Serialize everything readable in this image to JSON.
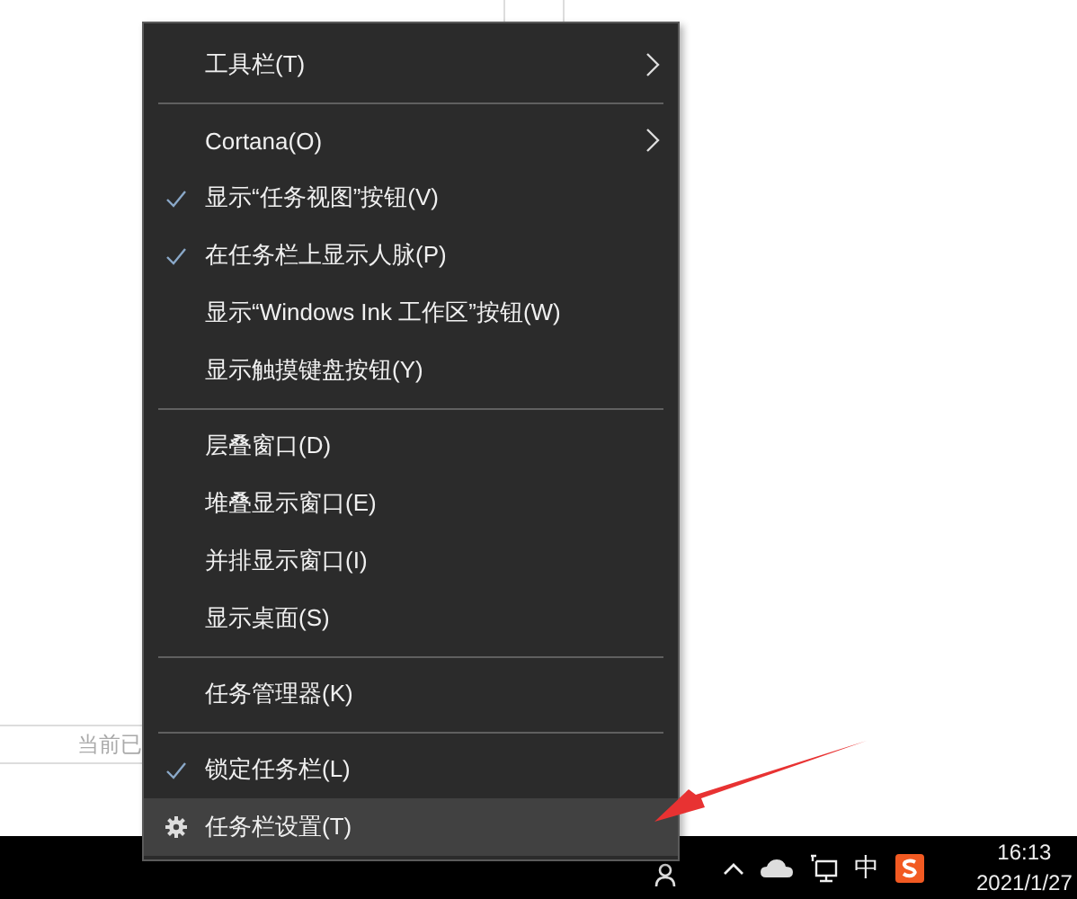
{
  "background": {
    "status_text": "当前已"
  },
  "menu": {
    "items": [
      {
        "kind": "item",
        "label": "工具栏(T)",
        "checked": false,
        "submenu": true,
        "selected": false
      },
      {
        "kind": "separator"
      },
      {
        "kind": "item",
        "label": "Cortana(O)",
        "checked": false,
        "submenu": true,
        "selected": false
      },
      {
        "kind": "item",
        "label": "显示“任务视图”按钮(V)",
        "checked": true,
        "submenu": false,
        "selected": false
      },
      {
        "kind": "item",
        "label": "在任务栏上显示人脉(P)",
        "checked": true,
        "submenu": false,
        "selected": false
      },
      {
        "kind": "item",
        "label": "显示“Windows Ink 工作区”按钮(W)",
        "checked": false,
        "submenu": false,
        "selected": false
      },
      {
        "kind": "item",
        "label": "显示触摸键盘按钮(Y)",
        "checked": false,
        "submenu": false,
        "selected": false
      },
      {
        "kind": "separator"
      },
      {
        "kind": "item",
        "label": "层叠窗口(D)",
        "checked": false,
        "submenu": false,
        "selected": false
      },
      {
        "kind": "item",
        "label": "堆叠显示窗口(E)",
        "checked": false,
        "submenu": false,
        "selected": false
      },
      {
        "kind": "item",
        "label": "并排显示窗口(I)",
        "checked": false,
        "submenu": false,
        "selected": false
      },
      {
        "kind": "item",
        "label": "显示桌面(S)",
        "checked": false,
        "submenu": false,
        "selected": false
      },
      {
        "kind": "separator"
      },
      {
        "kind": "item",
        "label": "任务管理器(K)",
        "checked": false,
        "submenu": false,
        "selected": false
      },
      {
        "kind": "separator"
      },
      {
        "kind": "item",
        "label": "锁定任务栏(L)",
        "checked": true,
        "submenu": false,
        "selected": false
      },
      {
        "kind": "settings",
        "label": "任务栏设置(T)",
        "checked": false,
        "submenu": false,
        "selected": true
      }
    ]
  },
  "taskbar": {
    "ime": "中",
    "time": "16:13",
    "date": "2021/1/27"
  }
}
